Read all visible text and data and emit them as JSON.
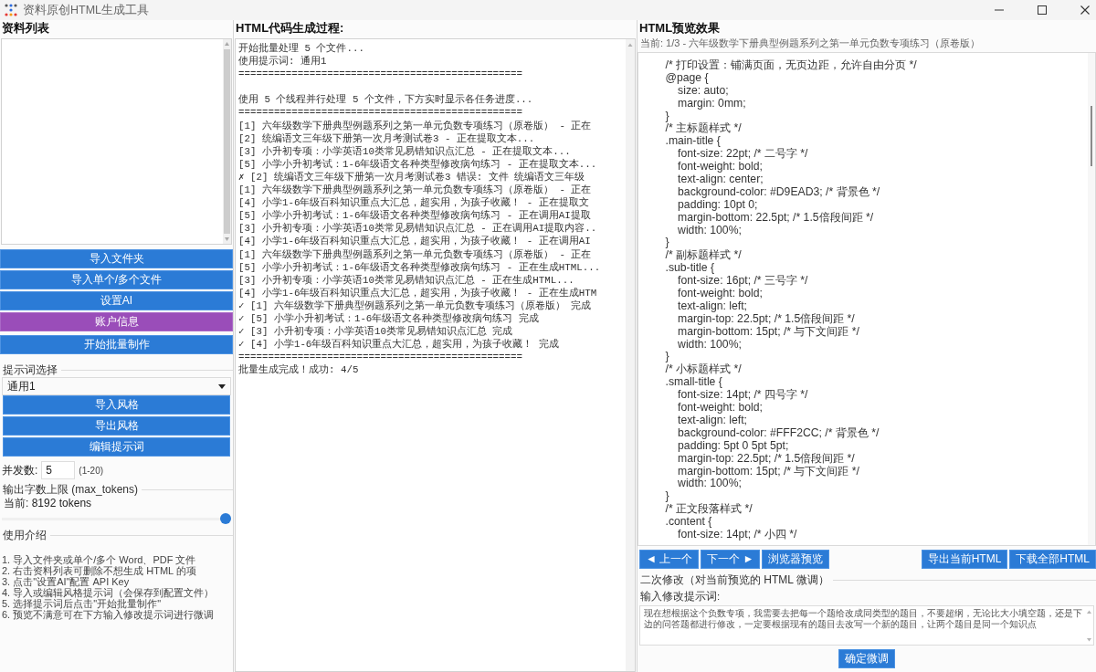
{
  "window": {
    "title": "资料原创HTML生成工具"
  },
  "file_panel": {
    "title": "资料列表",
    "buttons": [
      {
        "label": "导入文件夹",
        "kind": "primary"
      },
      {
        "label": "导入单个/多个文件",
        "kind": "primary"
      },
      {
        "label": "设置AI",
        "kind": "primary"
      },
      {
        "label": "账户信息",
        "kind": "account"
      },
      {
        "label": "开始批量制作",
        "kind": "start"
      }
    ]
  },
  "prompt_group": {
    "legend": "提示词选择",
    "select": {
      "value": "通用1"
    },
    "buttons": [
      "导入风格",
      "导出风格",
      "编辑提示词"
    ]
  },
  "concurrency": {
    "label": "并发数:",
    "value": "5",
    "hint": "(1-20)"
  },
  "max_tokens": {
    "legend": "输出字数上限 (max_tokens)",
    "current": "当前: 8192 tokens",
    "slider": {
      "level": 1
    }
  },
  "usage": {
    "legend": "使用介绍",
    "steps": [
      "1. 导入文件夹或单个/多个 Word、PDF 文件",
      "2. 右击资料列表可删除不想生成 HTML 的项",
      "3. 点击\"设置AI\"配置 API Key",
      "4. 导入或编辑风格提示词（会保存到配置文件）",
      "5. 选择提示词后点击\"开始批量制作\"",
      "6. 预览不满意可在下方输入修改提示词进行微调"
    ]
  },
  "log": {
    "title": "HTML代码生成过程:",
    "sections": [
      [
        "开始批量处理 5 个文件...",
        "使用提示词: 通用1",
        "================================================"
      ],
      [
        "使用 5 个线程并行处理 5 个文件，下方实时显示各任务进度...",
        "================================================",
        "[1] 六年级数学下册典型例题系列之第一单元负数专项练习（原卷版） - 正在",
        "[2] 统编语文三年级下册第一次月考测试卷3 - 正在提取文本...",
        "[3] 小升初专项：小学英语10类常见易错知识点汇总 - 正在提取文本...",
        "[5] 小学小升初考试：1-6年级语文各种类型修改病句练习 - 正在提取文本...",
        "✗ [2] 统编语文三年级下册第一次月考测试卷3 错误: 文件 统编语文三年级",
        "[1] 六年级数学下册典型例题系列之第一单元负数专项练习（原卷版） - 正在",
        "[4] 小学1-6年级百科知识重点大汇总，超实用，为孩子收藏！ - 正在提取文",
        "[5] 小学小升初考试：1-6年级语文各种类型修改病句练习 - 正在调用AI提取",
        "[3] 小升初专项：小学英语10类常见易错知识点汇总 - 正在调用AI提取内容..",
        "[4] 小学1-6年级百科知识重点大汇总，超实用，为孩子收藏！ - 正在调用AI",
        "[1] 六年级数学下册典型例题系列之第一单元负数专项练习（原卷版） - 正在",
        "[5] 小学小升初考试：1-6年级语文各种类型修改病句练习 - 正在生成HTML...",
        "[3] 小升初专项：小学英语10类常见易错知识点汇总 - 正在生成HTML...",
        "[4] 小学1-6年级百科知识重点大汇总，超实用，为孩子收藏！ - 正在生成HTM",
        "✓ [1] 六年级数学下册典型例题系列之第一单元负数专项练习（原卷版） 完成",
        "✓ [5] 小学小升初考试：1-6年级语文各种类型修改病句练习 完成",
        "✓ [3] 小升初专项：小学英语10类常见易错知识点汇总 完成",
        "✓ [4] 小学1-6年级百科知识重点大汇总，超实用，为孩子收藏！ 完成",
        "================================================",
        "批量生成完成！成功: 4/5"
      ]
    ]
  },
  "preview": {
    "title": "HTML预览效果",
    "current": "当前: 1/3 - 六年级数学下册典型例题系列之第一单元负数专项练习（原卷版）",
    "code_lines": [
      "    /* 打印设置：铺满页面，无页边距，允许自由分页 */",
      "    @page {",
      "        size: auto;",
      "        margin: 0mm;",
      "    }",
      "    /* 主标题样式 */",
      "    .main-title {",
      "        font-size: 22pt; /* 二号字 */",
      "        font-weight: bold;",
      "        text-align: center;",
      "        background-color: #D9EAD3; /* 背景色 */",
      "        padding: 10pt 0;",
      "        margin-bottom: 22.5pt; /* 1.5倍段间距 */",
      "        width: 100%;",
      "    }",
      "    /* 副标题样式 */",
      "    .sub-title {",
      "        font-size: 16pt; /* 三号字 */",
      "        font-weight: bold;",
      "        text-align: left;",
      "        margin-top: 22.5pt; /* 1.5倍段间距 */",
      "        margin-bottom: 15pt; /* 与下文间距 */",
      "        width: 100%;",
      "    }",
      "    /* 小标题样式 */",
      "    .small-title {",
      "        font-size: 14pt; /* 四号字 */",
      "        font-weight: bold;",
      "        text-align: left;",
      "        background-color: #FFF2CC; /* 背景色 */",
      "        padding: 5pt 0 5pt 5pt;",
      "        margin-top: 22.5pt; /* 1.5倍段间距 */",
      "        margin-bottom: 15pt; /* 与下文间距 */",
      "        width: 100%;",
      "    }",
      "    /* 正文段落样式 */",
      "    .content {",
      "        font-size: 14pt; /* 小四 */"
    ],
    "nav_buttons": [
      "◄ 上一个",
      "下一个 ►",
      "浏览器预览"
    ],
    "export_buttons": [
      "导出当前HTML",
      "下载全部HTML"
    ]
  },
  "refine": {
    "legend": "二次修改（对当前预览的 HTML 微调）",
    "label": "输入修改提示词:",
    "prompt_text": "现在想根据这个负数专项，我需要去把每一个题给改成同类型的题目，不要超纲，无论比大小填空题，还是下边的问答题都进行修改，一定要根据现有的题目去改写一个新的题目，让两个题目是同一个知识点",
    "button": "确定微调"
  }
}
